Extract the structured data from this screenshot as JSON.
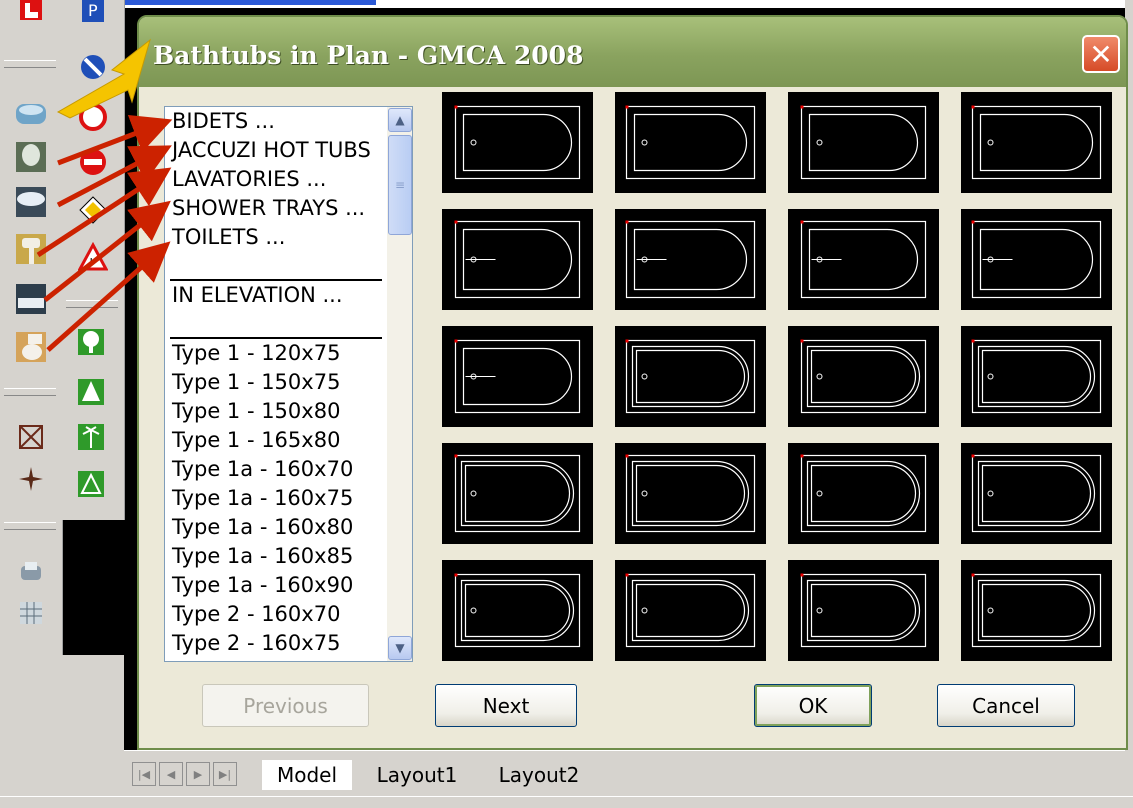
{
  "dialog": {
    "title": "Bathtubs in Plan - GMCA 2008",
    "close_glyph": "✕"
  },
  "categories": [
    "BIDETS ...",
    "JACCUZI HOT TUBS",
    "LAVATORIES ...",
    "SHOWER TRAYS ...",
    "TOILETS ..."
  ],
  "elevation_label": "IN ELEVATION ...",
  "types": [
    "Type 1 - 120x75",
    "Type 1 - 150x75",
    "Type 1 - 150x80",
    "Type 1 - 165x80",
    "Type 1a - 160x70",
    "Type 1a - 160x75",
    "Type 1a - 160x80",
    "Type 1a - 160x85",
    "Type 1a - 160x90",
    "Type 2 - 160x70",
    "Type 2 - 160x75"
  ],
  "buttons": {
    "previous": "Previous",
    "next": "Next",
    "ok": "OK",
    "cancel": "Cancel"
  },
  "layout_tabs": [
    "Model",
    "Layout1",
    "Layout2"
  ],
  "thumbnail_styles": [
    "single-dot",
    "single-dot",
    "single-dot",
    "single-dot",
    "single-line",
    "single-line",
    "single-line",
    "single-line",
    "single-line",
    "double-dot",
    "double-dot",
    "double-dot",
    "double-dot",
    "double-dot",
    "double-dot",
    "double-dot",
    "double-dot",
    "double-dot",
    "double-dot",
    "double-dot"
  ],
  "colors": {
    "title_bar": "#8aa35f",
    "arrow_red": "#cc2200",
    "arrow_yellow": "#f5c400",
    "drawing_line": "#ffffff"
  }
}
